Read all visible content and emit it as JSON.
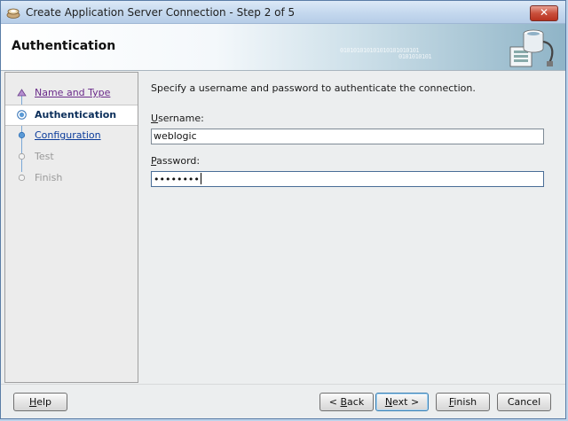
{
  "window": {
    "title": "Create Application Server Connection - Step 2 of 5",
    "close_label": "✕"
  },
  "header": {
    "title": "Authentication",
    "binary_line1": "010101010101010101010101",
    "binary_line2": "0101010101"
  },
  "steps": [
    {
      "label": "Name and Type",
      "state": "done"
    },
    {
      "label": "Authentication",
      "state": "current"
    },
    {
      "label": "Configuration",
      "state": "link"
    },
    {
      "label": "Test",
      "state": "disabled"
    },
    {
      "label": "Finish",
      "state": "disabled"
    }
  ],
  "form": {
    "instruction": "Specify a username and password to authenticate the connection.",
    "username_label_mnemonic": "U",
    "username_label_rest": "sername:",
    "username_value": "weblogic",
    "password_label_mnemonic": "P",
    "password_label_rest": "assword:",
    "password_masked": "••••••••"
  },
  "buttons": {
    "help_mnemonic": "H",
    "help_rest": "elp",
    "back_prefix": "< ",
    "back_mnemonic": "B",
    "back_rest": "ack",
    "next_mnemonic": "N",
    "next_rest": "ext >",
    "finish_mnemonic": "F",
    "finish_rest": "inish",
    "cancel_label": "Cancel"
  },
  "colors": {
    "titlebar": "#c4d8ee",
    "close_button": "#c9503c",
    "current_step_text": "#0b2e5a",
    "link_step_text": "#0a3b9a",
    "visited_step_text": "#6a2a8a"
  }
}
